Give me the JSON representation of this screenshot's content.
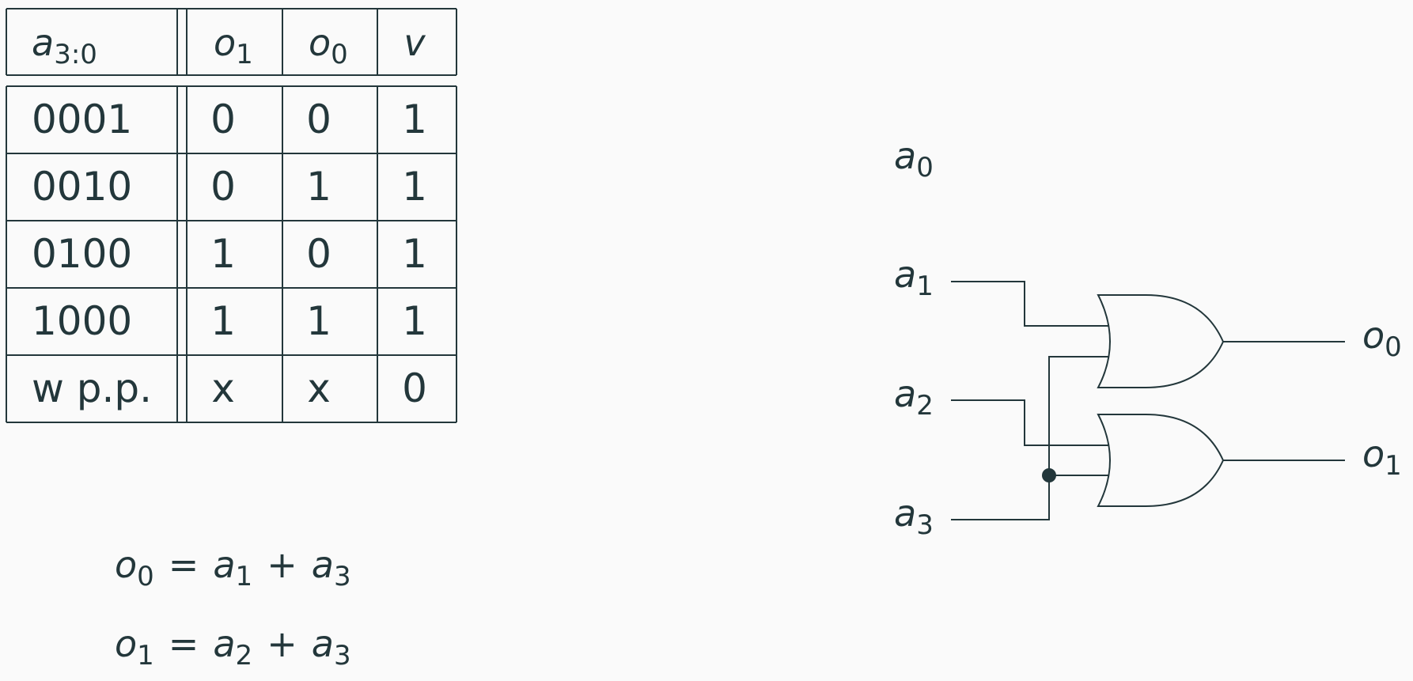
{
  "truth_table": {
    "header": {
      "input": {
        "base": "a",
        "sub": "3:0"
      },
      "outputs": [
        {
          "base": "o",
          "sub": "1"
        },
        {
          "base": "o",
          "sub": "0"
        },
        {
          "base": "v",
          "sub": ""
        }
      ]
    },
    "rows": [
      {
        "input": "0001",
        "o1": "0",
        "o0": "0",
        "v": "1"
      },
      {
        "input": "0010",
        "o1": "0",
        "o0": "1",
        "v": "1"
      },
      {
        "input": "0100",
        "o1": "1",
        "o0": "0",
        "v": "1"
      },
      {
        "input": "1000",
        "o1": "1",
        "o0": "1",
        "v": "1"
      },
      {
        "input": "w p.p.",
        "o1": "x",
        "o0": "x",
        "v": "0"
      }
    ]
  },
  "equations": [
    {
      "lhs": {
        "base": "o",
        "sub": "0"
      },
      "eq": "=",
      "plus": "+",
      "terms": [
        {
          "base": "a",
          "sub": "1"
        },
        {
          "base": "a",
          "sub": "3"
        }
      ]
    },
    {
      "lhs": {
        "base": "o",
        "sub": "1"
      },
      "eq": "=",
      "plus": "+",
      "terms": [
        {
          "base": "a",
          "sub": "2"
        },
        {
          "base": "a",
          "sub": "3"
        }
      ]
    }
  ],
  "circuit": {
    "inputs": [
      {
        "base": "a",
        "sub": "0"
      },
      {
        "base": "a",
        "sub": "1"
      },
      {
        "base": "a",
        "sub": "2"
      },
      {
        "base": "a",
        "sub": "3"
      }
    ],
    "outputs": [
      {
        "base": "o",
        "sub": "0"
      },
      {
        "base": "o",
        "sub": "1"
      }
    ],
    "gates": [
      {
        "type": "OR"
      },
      {
        "type": "OR"
      }
    ]
  }
}
